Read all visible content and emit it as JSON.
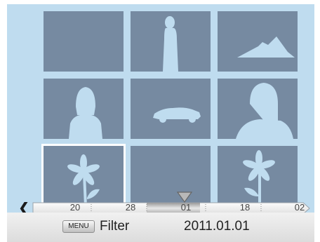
{
  "thumbnails": [
    {
      "icon": "blank-photo-icon"
    },
    {
      "icon": "person-photo-icon"
    },
    {
      "icon": "mountain-photo-icon"
    },
    {
      "icon": "portrait-photo-icon"
    },
    {
      "icon": "car-photo-icon"
    },
    {
      "icon": "person-silhouette-photo-icon"
    },
    {
      "icon": "flower-photo-icon",
      "selected": true
    },
    {
      "icon": "blank-photo-icon"
    },
    {
      "icon": "flower-photo-icon"
    }
  ],
  "timeline": {
    "labels": [
      "20",
      "28",
      "01",
      "18",
      "02"
    ],
    "current": "01",
    "left_arrow_icon": "chevron-left-icon",
    "marker_icon": "triangle-marker-icon"
  },
  "bottom_bar": {
    "menu_key": "MENU",
    "filter_label": "Filter",
    "date": "2011.01.01"
  },
  "colors": {
    "background": "#bfdcef",
    "thumbnail": "#768aa1",
    "silhouette": "#bfdcef",
    "selection": "#ffffff"
  }
}
